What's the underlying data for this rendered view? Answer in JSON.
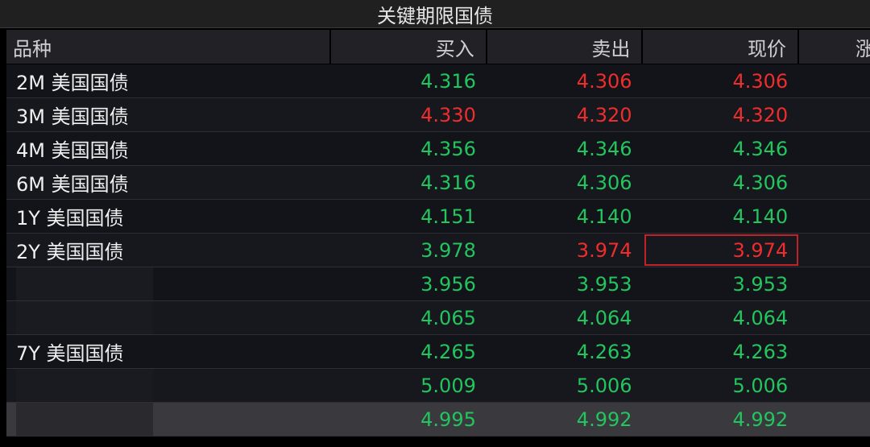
{
  "title": "关键期限国债",
  "headers": {
    "name": "品种",
    "buy": "买入",
    "sell": "卖出",
    "price": "现价",
    "partial": "涨"
  },
  "colors": {
    "up": "#ef2d2d",
    "down": "#22c55e",
    "highlight_border": "#c0222a"
  },
  "rows": [
    {
      "name": "2M 美国国债",
      "buy": "4.316",
      "sell": "4.306",
      "price": "4.306"
    },
    {
      "name": "3M 美国国债",
      "buy": "4.330",
      "sell": "4.320",
      "price": "4.320"
    },
    {
      "name": "4M 美国国债",
      "buy": "4.356",
      "sell": "4.346",
      "price": "4.346"
    },
    {
      "name": "6M 美国国债",
      "buy": "4.316",
      "sell": "4.306",
      "price": "4.306"
    },
    {
      "name": "1Y 美国国债",
      "buy": "4.151",
      "sell": "4.140",
      "price": "4.140"
    },
    {
      "name": "2Y 美国国债",
      "buy": "3.978",
      "sell": "3.974",
      "price": "3.974"
    },
    {
      "name": "",
      "buy": "3.956",
      "sell": "3.953",
      "price": "3.953"
    },
    {
      "name": "",
      "buy": "4.065",
      "sell": "4.064",
      "price": "4.064"
    },
    {
      "name": "7Y 美国国债",
      "buy": "4.265",
      "sell": "4.263",
      "price": "4.263"
    },
    {
      "name": "",
      "buy": "5.009",
      "sell": "5.006",
      "price": "5.006"
    },
    {
      "name": "",
      "buy": "4.995",
      "sell": "4.992",
      "price": "4.992"
    }
  ]
}
